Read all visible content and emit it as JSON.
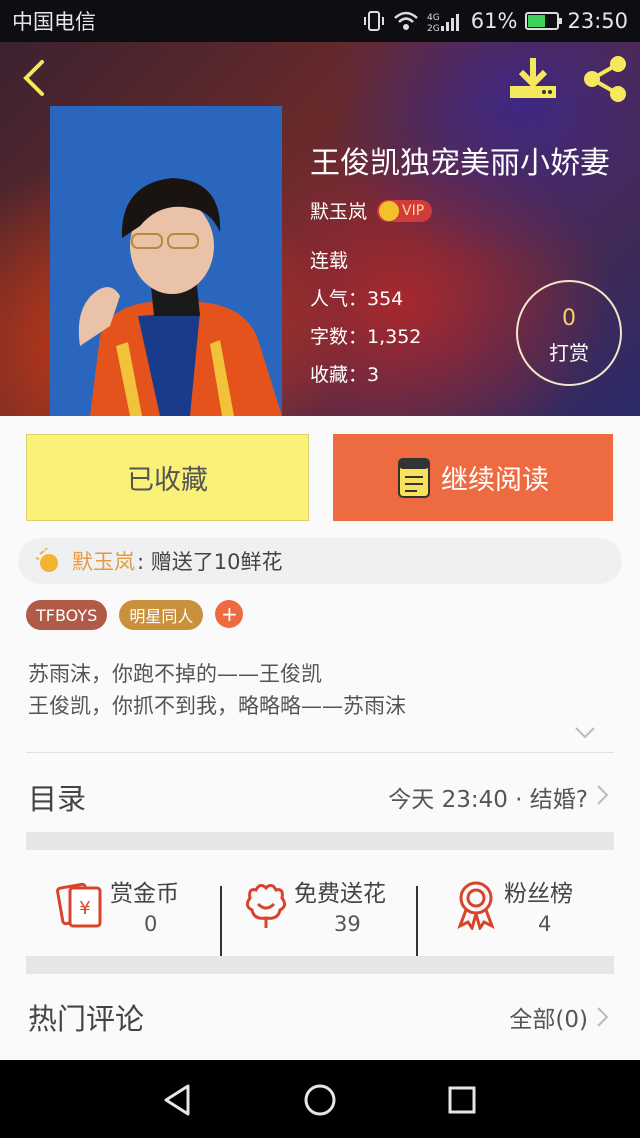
{
  "status_bar": {
    "carrier": "中国电信",
    "network": "4G 2G",
    "battery_text": "61%",
    "battery_level": 0.61,
    "time": "23:50"
  },
  "header": {
    "back_icon": "chevron-left-icon",
    "download_icon": "download-icon",
    "share_icon": "share-icon"
  },
  "book": {
    "title": "王俊凯独宠美丽小娇妻",
    "author": "默玉岚",
    "vip_label": "VIP",
    "status": "连载",
    "popularity": "人气：354",
    "word_count": "字数：1,352",
    "favorites": "收藏：3",
    "tip_count": "0",
    "tip_label": "打赏"
  },
  "buttons": {
    "collected_label": "已收藏",
    "read_label": "继续阅读"
  },
  "gift_banner": {
    "name": "默玉岚",
    "text": ": 赠送了10鲜花"
  },
  "tags": {
    "items": [
      "TFBOYS",
      "明星同人"
    ],
    "add_label": "+"
  },
  "summary": {
    "line1": "苏雨沫，你跑不掉的——王俊凯",
    "line2": "王俊凯，你抓不到我，略略略——苏雨沫"
  },
  "toc": {
    "title": "目录",
    "latest": "今天 23:40 · 结婚?"
  },
  "actions": [
    {
      "label": "赏金币",
      "count": "0",
      "icon": "red-envelope-icon"
    },
    {
      "label": "免费送花",
      "count": "39",
      "icon": "flower-icon"
    },
    {
      "label": "粉丝榜",
      "count": "4",
      "icon": "medal-icon"
    }
  ],
  "comments": {
    "title": "热门评论",
    "all_label": "全部(0)"
  },
  "colors": {
    "accent_orange": "#ee6b41",
    "collected_yellow": "#faf178",
    "icon_red": "#d8432b",
    "gift_name": "#e89a3c"
  }
}
